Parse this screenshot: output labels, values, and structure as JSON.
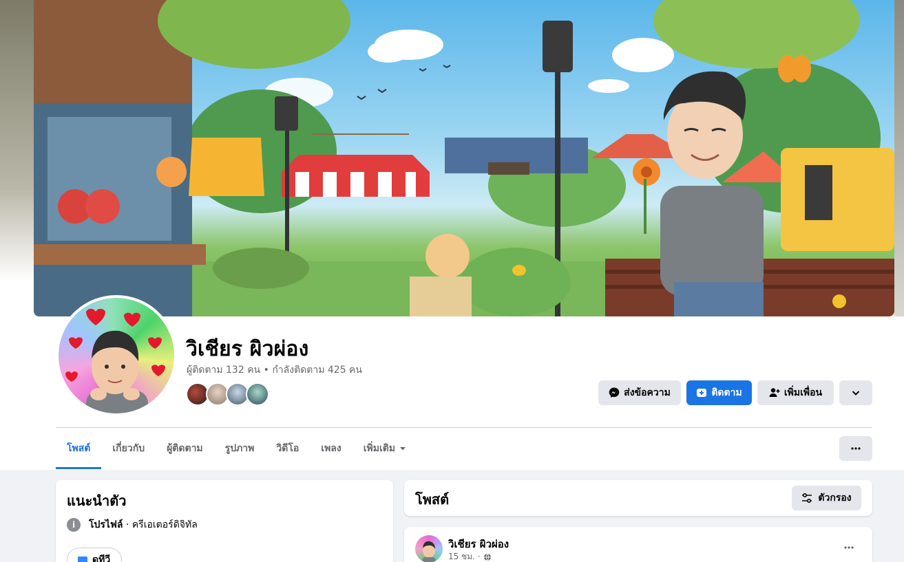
{
  "profile": {
    "name": "วิเชียร ผิวผ่อง",
    "stats_followers": "ผู้ติดตาม 132 คน",
    "stats_separator": " • ",
    "stats_following": "กำลังติดตาม 425 คน"
  },
  "actions": {
    "message_label": "ส่งข้อความ",
    "follow_label": "ติดตาม",
    "add_friend_label": "เพิ่มเพื่อน"
  },
  "tabs": [
    {
      "label": "โพสต์",
      "active": true
    },
    {
      "label": "เกี่ยวกับ"
    },
    {
      "label": "ผู้ติดตาม"
    },
    {
      "label": "รูปภาพ"
    },
    {
      "label": "วิดีโอ"
    },
    {
      "label": "เพลง"
    },
    {
      "label": "เพิ่มเติม"
    }
  ],
  "intro": {
    "title": "แนะนำตัว",
    "profile_label": "โปรไฟล์",
    "profile_detail": " · ครีเอเตอร์ดิจิทัล",
    "tv_label": "ดูทีวี"
  },
  "posts": {
    "title": "โพสต์",
    "filter_label": "ตัวกรอง",
    "items": [
      {
        "author": "วิเชียร ผิวผ่อง",
        "time": "15 ชม. ·"
      }
    ]
  },
  "colors": {
    "accent": "#1b74e4",
    "button_gray": "#e4e6eb",
    "background": "#f0f2f5",
    "secondary_text": "#65676b"
  }
}
